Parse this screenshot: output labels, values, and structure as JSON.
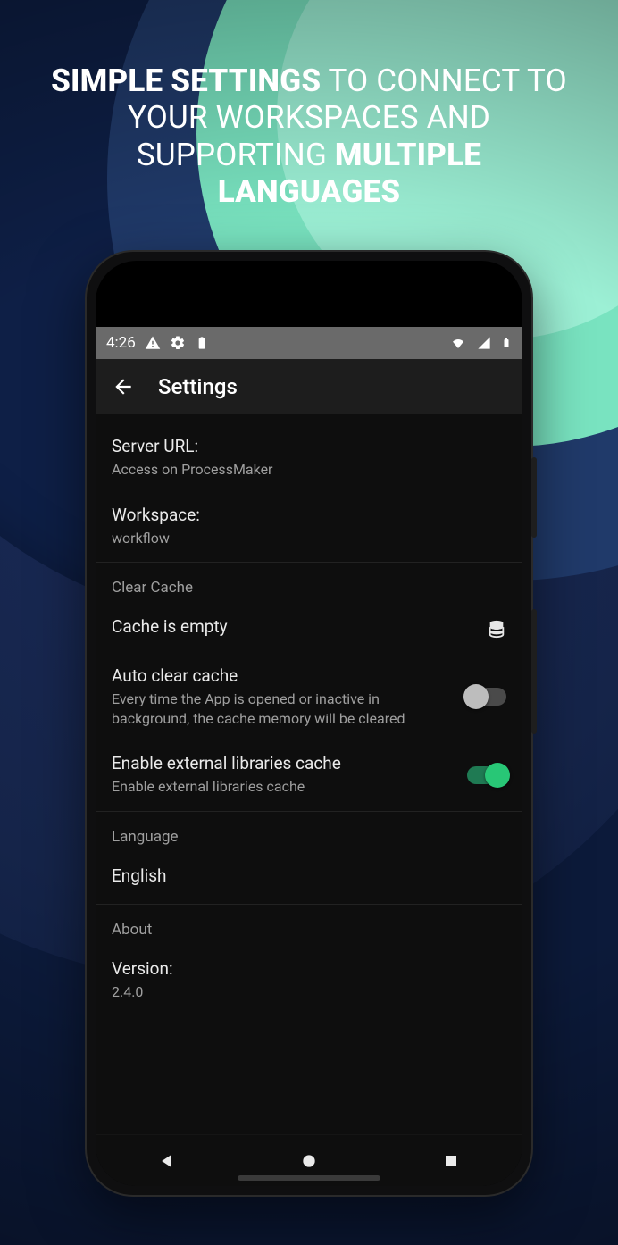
{
  "promo": {
    "line1_bold": "SIMPLE SETTINGS",
    "line1_rest": " TO CONNECT TO",
    "line2": "YOUR WORKSPACES AND",
    "line3_a": "SUPPORTING ",
    "line3_bold": "MULTIPLE",
    "line4_bold": "LANGUAGES"
  },
  "statusbar": {
    "time": "4:26"
  },
  "appbar": {
    "title": "Settings"
  },
  "server": {
    "label": "Server URL:",
    "value": "Access on ProcessMaker"
  },
  "workspace": {
    "label": "Workspace:",
    "value": "workflow"
  },
  "cache": {
    "group": "Clear Cache",
    "emptyLabel": "Cache is empty",
    "auto": {
      "label": "Auto clear cache",
      "desc": "Every time the App is opened or inactive in background, the cache memory will be cleared",
      "on": false
    },
    "external": {
      "label": "Enable external libraries cache",
      "desc": "Enable external libraries cache",
      "on": true
    }
  },
  "language": {
    "group": "Language",
    "value": "English"
  },
  "about": {
    "group": "About",
    "versionLabel": "Version:",
    "version": "2.4.0"
  }
}
